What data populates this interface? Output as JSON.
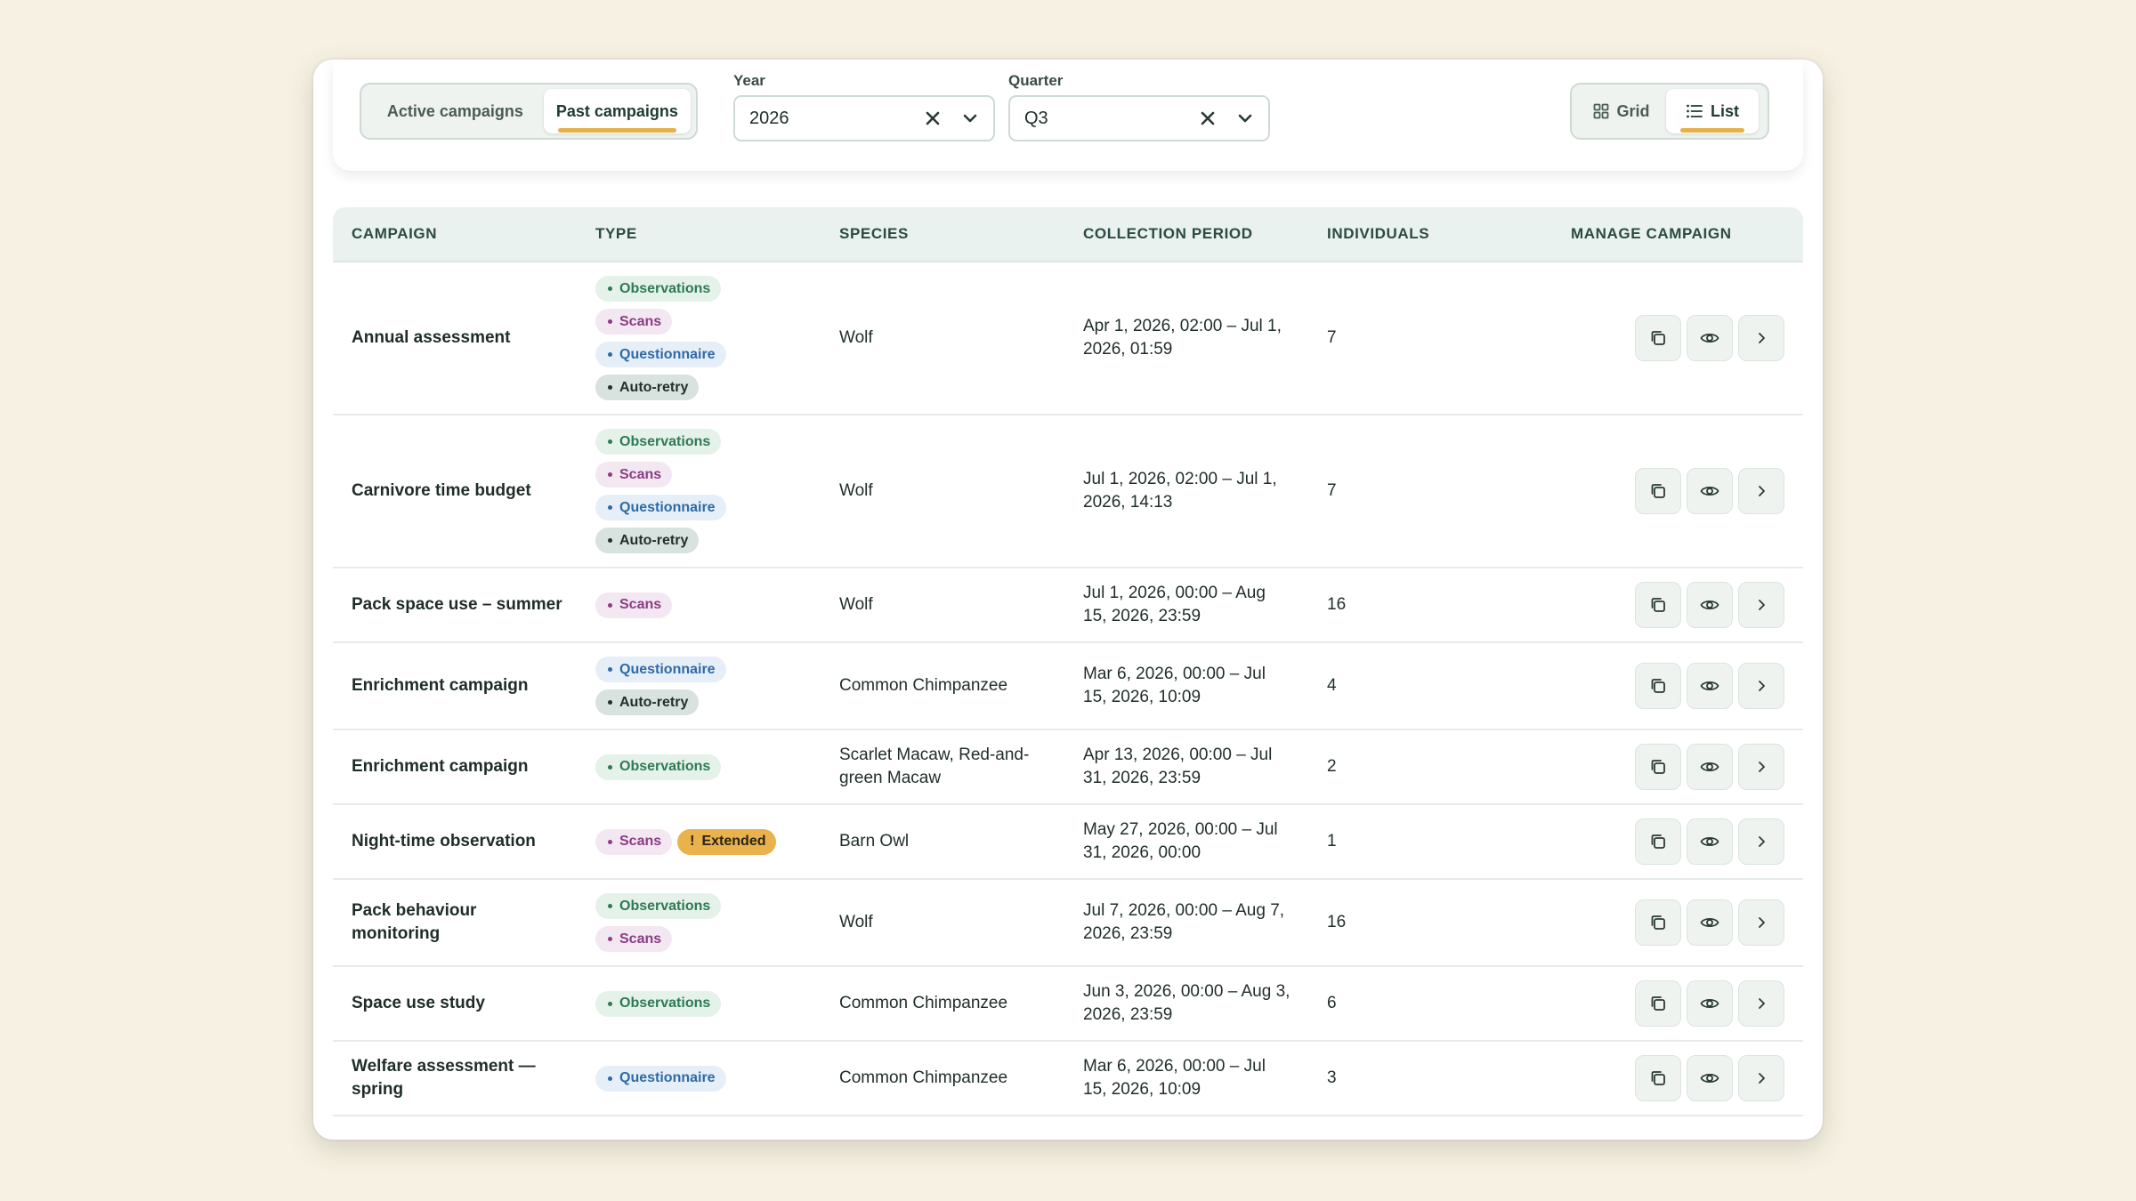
{
  "tabs": {
    "active_label": "Active campaigns",
    "past_label": "Past campaigns"
  },
  "filters": {
    "year_label": "Year",
    "year_value": "2026",
    "quarter_label": "Quarter",
    "quarter_value": "Q3"
  },
  "view_toggle": {
    "grid_label": "Grid",
    "list_label": "List"
  },
  "table": {
    "headers": [
      "CAMPAIGN",
      "TYPE",
      "SPECIES",
      "COLLECTION PERIOD",
      "INDIVIDUALS",
      "MANAGE CAMPAIGN"
    ],
    "rows": [
      {
        "name": "Annual assessment",
        "types": [
          "Observations",
          "Scans",
          "Questionnaire",
          "Auto-retry"
        ],
        "species": "Wolf",
        "period": "Apr 1, 2026, 02:00 – Jul 1, 2026, 01:59",
        "individuals": "7"
      },
      {
        "name": "Carnivore time budget",
        "types": [
          "Observations",
          "Scans",
          "Questionnaire",
          "Auto-retry"
        ],
        "species": "Wolf",
        "period": "Jul 1, 2026, 02:00 – Jul 1, 2026, 14:13",
        "individuals": "7"
      },
      {
        "name": "Pack space use – summer",
        "types": [
          "Scans"
        ],
        "species": "Wolf",
        "period": "Jul 1, 2026, 00:00 – Aug 15, 2026, 23:59",
        "individuals": "16"
      },
      {
        "name": "Enrichment campaign",
        "types": [
          "Questionnaire",
          "Auto-retry"
        ],
        "species": "Common Chimpanzee",
        "period": "Mar 6, 2026, 00:00 – Jul 15, 2026, 10:09",
        "individuals": "4"
      },
      {
        "name": "Enrichment campaign",
        "types": [
          "Observations"
        ],
        "species": "Scarlet Macaw, Red-and-green Macaw",
        "period": "Apr 13, 2026, 00:00 – Jul 31, 2026, 23:59",
        "individuals": "2"
      },
      {
        "name": "Night-time observation",
        "types": [
          "Scans"
        ],
        "extended": "Extended",
        "species": "Barn Owl",
        "period": "May 27, 2026, 00:00 – Jul 31, 2026, 00:00",
        "individuals": "1"
      },
      {
        "name": "Pack behaviour monitoring",
        "types": [
          "Observations",
          "Scans"
        ],
        "species": "Wolf",
        "period": "Jul 7, 2026, 00:00 – Aug 7, 2026, 23:59",
        "individuals": "16"
      },
      {
        "name": "Space use study",
        "types": [
          "Observations"
        ],
        "species": "Common Chimpanzee",
        "period": "Jun 3, 2026, 00:00 – Aug 3, 2026, 23:59",
        "individuals": "6"
      },
      {
        "name": "Welfare assessment — spring",
        "types": [
          "Questionnaire"
        ],
        "species": "Common Chimpanzee",
        "period": "Mar 6, 2026, 00:00 – Jul 15, 2026, 10:09",
        "individuals": "3"
      }
    ]
  },
  "icons": {
    "clear": "close-icon",
    "dropdown": "chevron-down-icon",
    "grid": "grid-icon",
    "list": "list-icon",
    "duplicate": "copy-icon",
    "view": "eye-icon",
    "open": "chevron-right-icon"
  },
  "colors": {
    "accent": "#e6b04a",
    "observations": "#2e7a52",
    "scans": "#8c3d83",
    "questionnaire": "#2f6aa6",
    "auto_retry": "#22302c",
    "extended": "#e9b24c"
  }
}
